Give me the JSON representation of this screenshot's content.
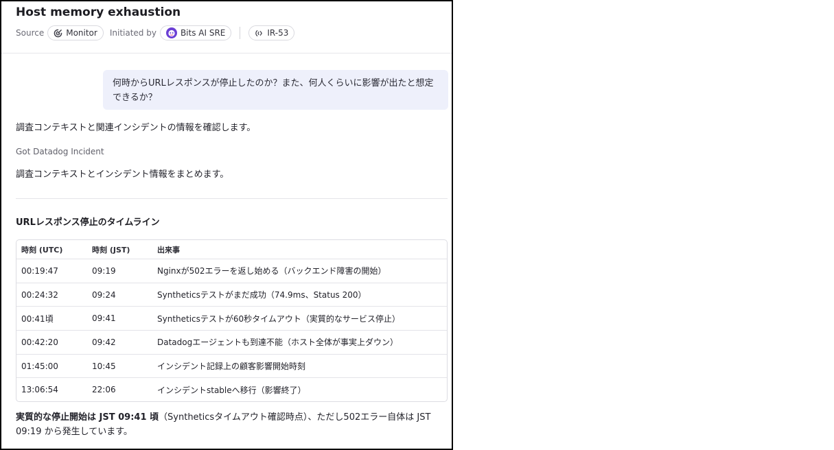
{
  "header": {
    "title": "Host memory exhaustion",
    "source_label": "Source",
    "source_value": "Monitor",
    "initiated_label": "Initiated by",
    "initiated_value": "Bits AI SRE",
    "incident_id": "IR-53"
  },
  "chat": {
    "user_question": "何時からURLレスポンスが停止したのか？また、何人くらいに影響が出たと想定できるか？",
    "reply_1": "調査コンテキストと関連インシデントの情報を確認します。",
    "tool_status": "Got Datadog Incident",
    "reply_2": "調査コンテキストとインシデント情報をまとめます。"
  },
  "timeline": {
    "heading": "URLレスポンス停止のタイムライン",
    "columns": [
      "時刻 (UTC)",
      "時刻 (JST)",
      "出来事"
    ],
    "rows": [
      [
        "00:19:47",
        "09:19",
        "Nginxが502エラーを返し始める（バックエンド障害の開始）"
      ],
      [
        "00:24:32",
        "09:24",
        "Syntheticsテストがまだ成功（74.9ms、Status 200）"
      ],
      [
        "00:41頃",
        "09:41",
        "Syntheticsテストが60秒タイムアウト（実質的なサービス停止）"
      ],
      [
        "00:42:20",
        "09:42",
        "Datadogエージェントも到達不能（ホスト全体が事実上ダウン）"
      ],
      [
        "01:45:00",
        "10:45",
        "インシデント記録上の顧客影響開始時刻"
      ],
      [
        "13:06:54",
        "22:06",
        "インシデントstableへ移行（影響終了）"
      ]
    ]
  },
  "summary": {
    "bold": "実質的な停止開始は JST 09:41 頃",
    "rest": "（Syntheticsタイムアウト確認時点）、ただし502エラー自体は JST 09:19 から発生しています。"
  },
  "colors": {
    "bubble_bg": "#eef0fb",
    "avatar": "#6b3fd4",
    "border": "#000000"
  }
}
